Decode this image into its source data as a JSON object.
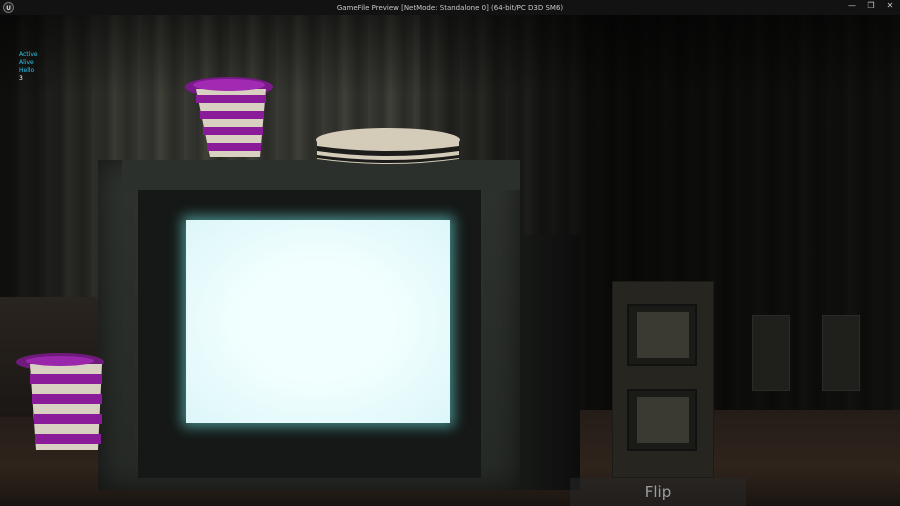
{
  "window": {
    "title": "GameFile Preview [NetMode: Standalone 0]  (64-bit/PC D3D SM6)",
    "logo_glyph": "U",
    "minimize_glyph": "—",
    "maximize_glyph": "❐",
    "close_glyph": "✕"
  },
  "hud": {
    "lines": [
      "Active",
      "Alive",
      "Hello"
    ],
    "value": "3"
  },
  "actions": {
    "flip_label": "Flip"
  },
  "colors": {
    "hud_text": "#2ec6f0",
    "screen_glow": "#e8fcfd",
    "hat_purple": "#8a1c99",
    "hat_stripe": "#d8d0c0"
  }
}
